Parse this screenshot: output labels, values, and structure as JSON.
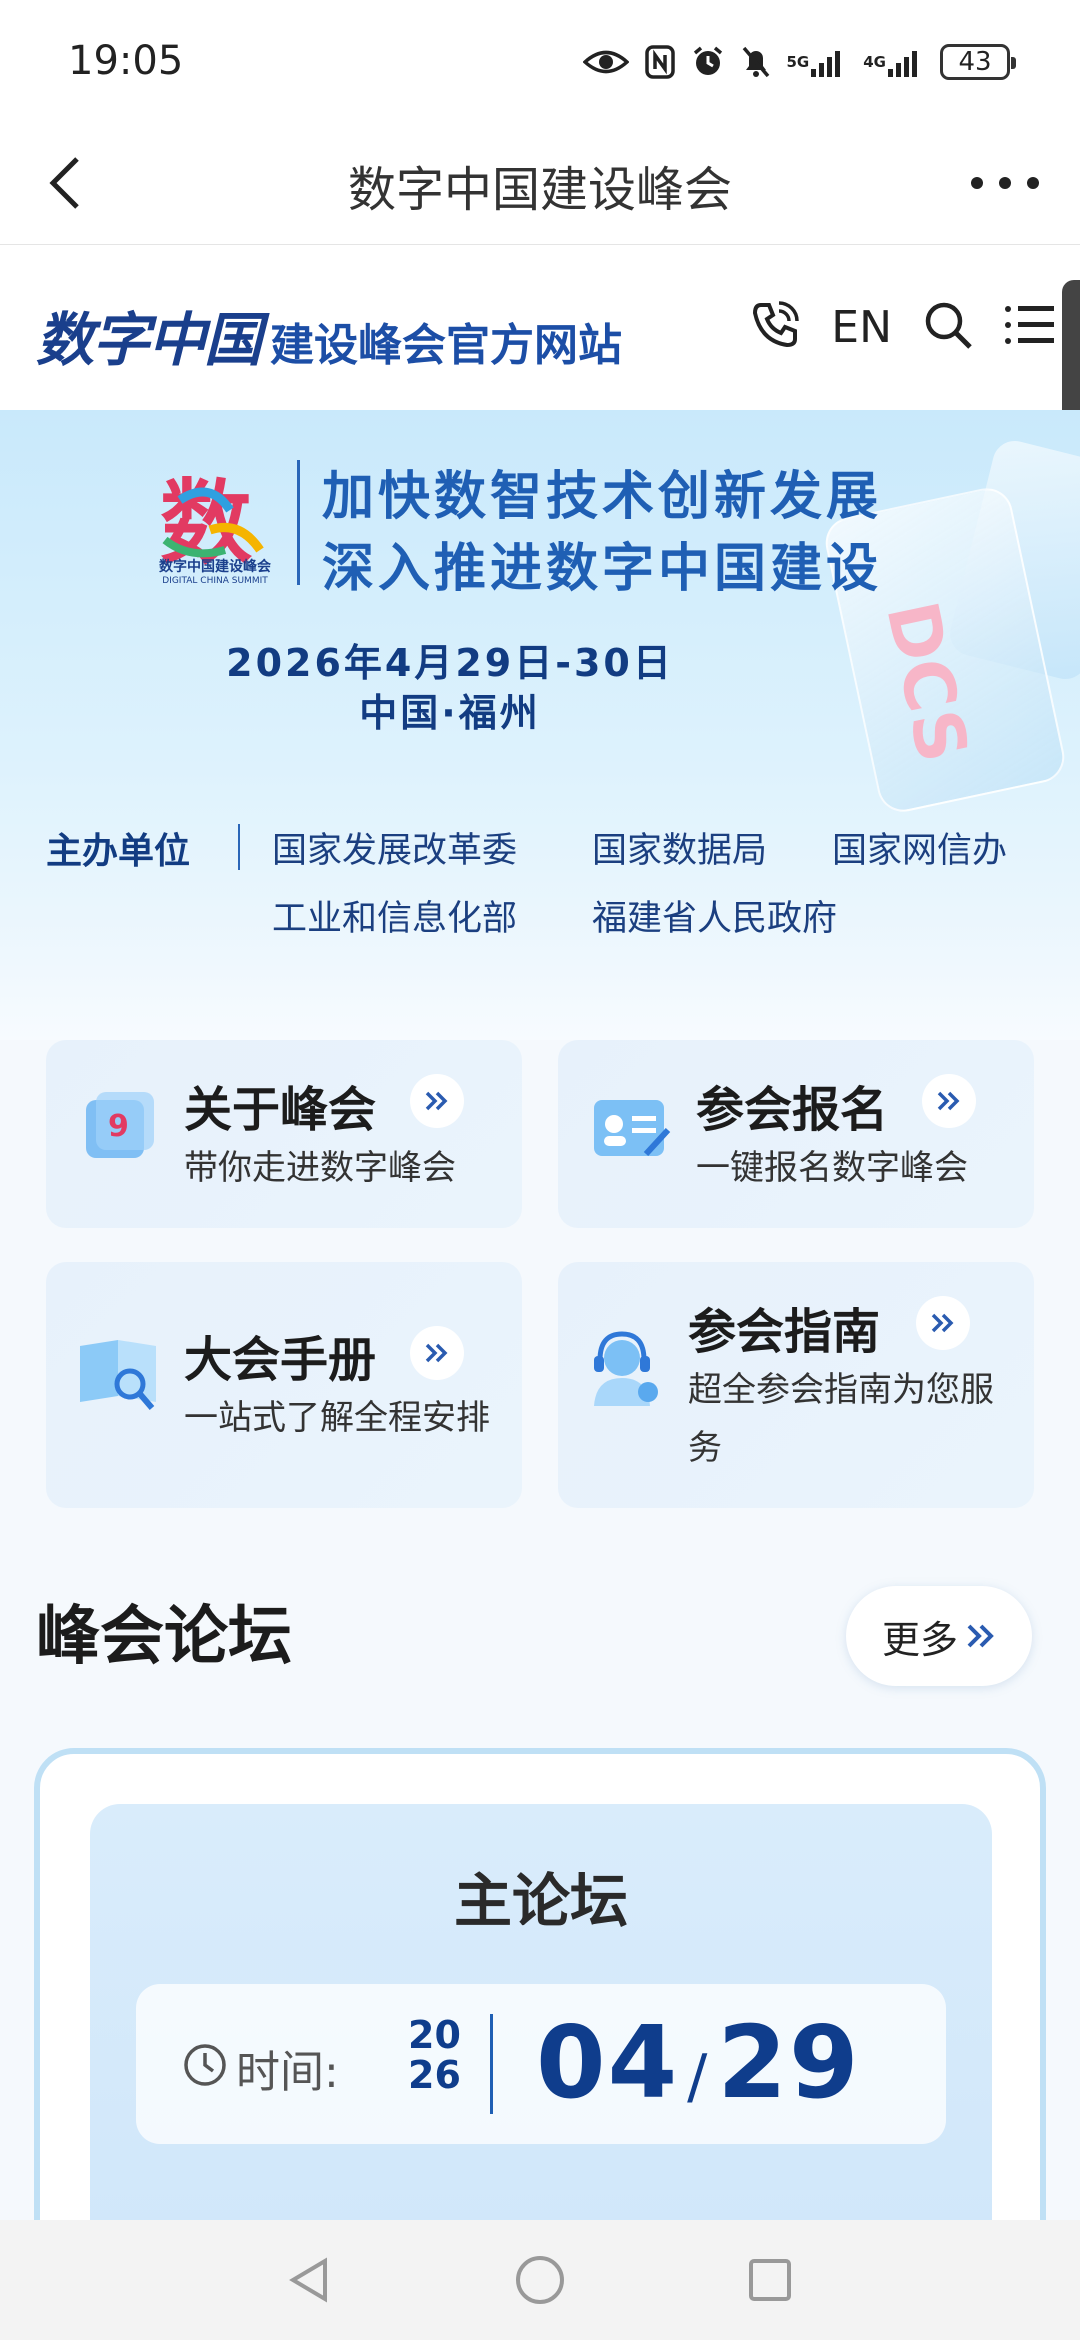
{
  "status_bar": {
    "time": "19:05",
    "network_1": "5G",
    "network_2": "4G",
    "battery": "43"
  },
  "app_bar": {
    "title": "数字中国建设峰会"
  },
  "site_header": {
    "logo_script": "数字中国",
    "logo_text": "建设峰会官方网站",
    "lang_label": "EN"
  },
  "banner": {
    "emblem_char": "数",
    "emblem_name": "数字中国建设峰会",
    "emblem_name_en": "DIGITAL CHINA SUMMIT",
    "slogan_line1": "加快数智技术创新发展",
    "slogan_line2": "深入推进数字中国建设",
    "date": "2026年4月29日-30日",
    "place": "中国·福州",
    "deco_text": "DCS"
  },
  "organizers": {
    "label": "主办单位",
    "items": [
      "国家发展改革委",
      "国家数据局",
      "国家网信办",
      "工业和信息化部",
      "福建省人民政府"
    ]
  },
  "quick_links": [
    {
      "title": "关于峰会",
      "desc": "带你走进数字峰会",
      "icon": "cube-icon"
    },
    {
      "title": "参会报名",
      "desc": "一键报名数字峰会",
      "icon": "registration-icon"
    },
    {
      "title": "大会手册",
      "desc": "一站式了解全程安排",
      "icon": "handbook-icon"
    },
    {
      "title": "参会指南",
      "desc": "超全参会指南为您服务",
      "icon": "support-icon"
    }
  ],
  "forum": {
    "section_title": "峰会论坛",
    "more_label": "更多",
    "card": {
      "name": "主论坛",
      "time_label": "时间:",
      "year_top": "20",
      "year_bottom": "26",
      "month": "04",
      "day": "29"
    }
  },
  "colors": {
    "brand_blue": "#1f5fb4",
    "dark_blue": "#0f3d8c",
    "banner_bg": "#d6eefc",
    "card_bg": "#e7f1fb"
  }
}
